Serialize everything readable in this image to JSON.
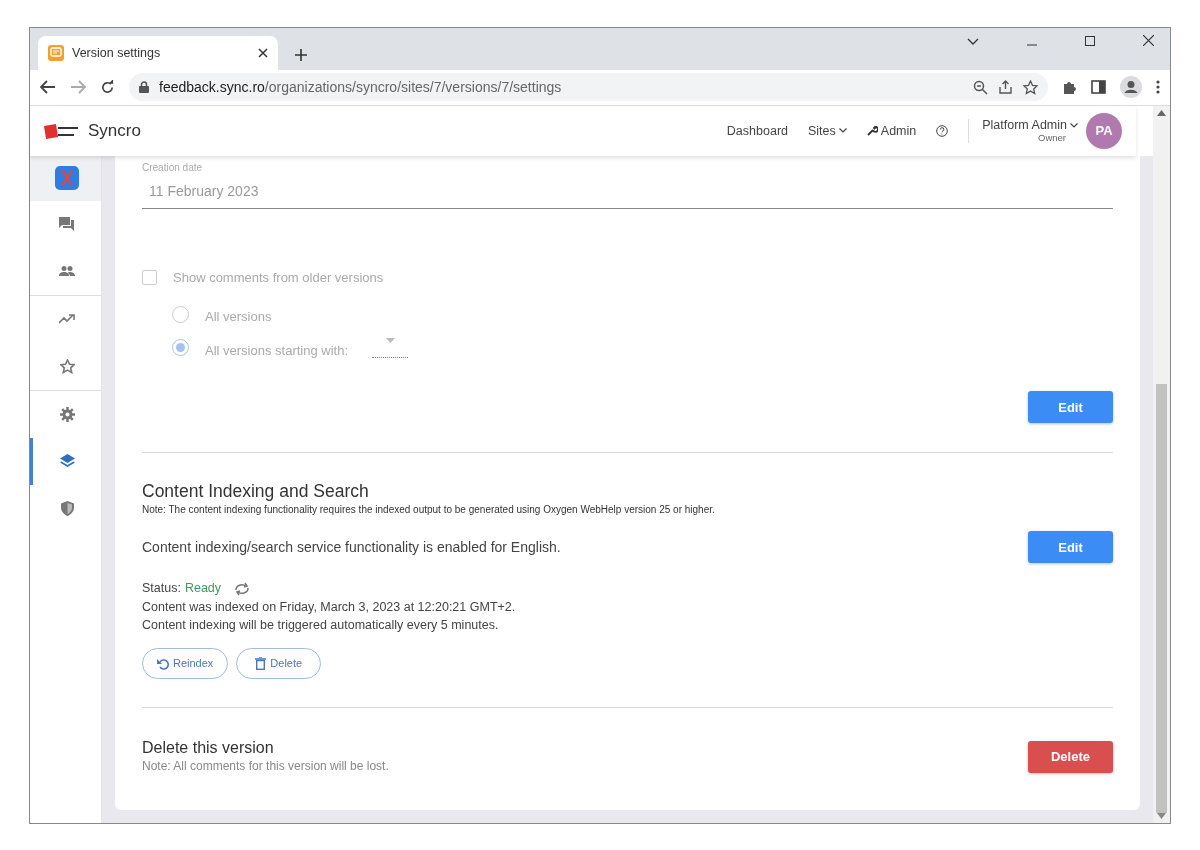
{
  "browser": {
    "tab_title": "Version settings",
    "url_host": "feedback.sync.ro",
    "url_path": "/organizations/syncro/sites/7/versions/7/settings"
  },
  "navbar": {
    "brand": "Syncro",
    "links": [
      {
        "kind": "link",
        "label": "Dashboard"
      },
      {
        "kind": "dropdown",
        "label": "Sites"
      },
      {
        "kind": "tool",
        "label": "Admin"
      },
      {
        "kind": "help"
      }
    ],
    "user": {
      "name": "Platform Admin",
      "role": "Owner",
      "initials": "PA"
    }
  },
  "sidebar": {
    "groups": [
      [
        {
          "kind": "app",
          "selected": false
        },
        {
          "kind": "comments",
          "selected": false
        },
        {
          "kind": "users",
          "selected": false
        }
      ],
      [
        {
          "kind": "trend",
          "selected": false
        },
        {
          "kind": "star",
          "selected": false
        }
      ],
      [
        {
          "kind": "settings",
          "selected": false
        },
        {
          "kind": "layers",
          "selected": true
        },
        {
          "kind": "shield",
          "selected": false
        }
      ]
    ]
  },
  "version": {
    "creation_date": {
      "label": "Creation date",
      "value": "11 February 2023"
    },
    "show_older": {
      "label": "Show comments from older versions",
      "checked": false,
      "disabled": true
    },
    "options": [
      {
        "label": "All versions",
        "selected": false
      },
      {
        "label": "All versions starting with:",
        "selected": true
      }
    ],
    "edit_button": "Edit"
  },
  "indexing": {
    "title": "Content Indexing and Search",
    "note": "Note: The content indexing functionality requires the indexed output to be generated using Oxygen WebHelp version 25 or higher.",
    "enabled_text": "Content indexing/search service functionality is enabled for English.",
    "edit_button": "Edit",
    "status_label": "Status:",
    "status_value": "Ready",
    "lines": [
      "Content was indexed on Friday, March 3, 2023 at 12:20:21 GMT+2.",
      "Content indexing will be triggered automatically every 5 minutes."
    ],
    "buttons": [
      {
        "kind": "reindex",
        "label": "Reindex"
      },
      {
        "kind": "delete",
        "label": "Delete"
      }
    ]
  },
  "delete_version": {
    "title": "Delete this version",
    "note": "Note: All comments for this version will be lost.",
    "button": "Delete"
  }
}
